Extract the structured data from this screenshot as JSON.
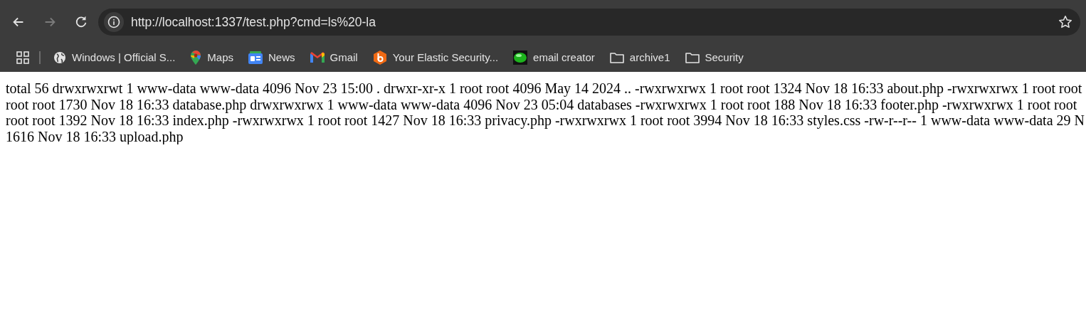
{
  "toolbar": {
    "nav_buttons": [
      {
        "kind": "back",
        "disabled": false
      },
      {
        "kind": "forward",
        "disabled": true
      },
      {
        "kind": "reload",
        "disabled": false
      }
    ],
    "url": "http://localhost:1337/test.php?cmd=ls%20-la"
  },
  "bookmarks": [
    {
      "kind": "globe",
      "label": "Windows | Official S..."
    },
    {
      "kind": "pin",
      "label": "Maps"
    },
    {
      "kind": "news",
      "label": "News"
    },
    {
      "kind": "mail",
      "label": "Gmail"
    },
    {
      "kind": "hexagon",
      "label": "Your Elastic Security..."
    },
    {
      "kind": "orb",
      "label": "email creator"
    },
    {
      "kind": "folder",
      "label": "archive1"
    },
    {
      "kind": "folder",
      "label": "Security"
    }
  ],
  "page": {
    "lines": [
      "total 56 drwxrwxrwt 1 www-data www-data 4096 Nov 23 15:00 . drwxr-xr-x 1 root root 4096 May 14 2024 .. -rwxrwxrwx 1 root root 1324 Nov 18 16:33 about.php -rwxrwxrwx 1 root root",
      "root root 1730 Nov 18 16:33 database.php drwxrwxrwx 1 www-data www-data 4096 Nov 23 05:04 databases -rwxrwxrwx 1 root root 188 Nov 18 16:33 footer.php -rwxrwxrwx 1 root root",
      "root root 1392 Nov 18 16:33 index.php -rwxrwxrwx 1 root root 1427 Nov 18 16:33 privacy.php -rwxrwxrwx 1 root root 3994 Nov 18 16:33 styles.css -rw-r--r-- 1 www-data www-data 29 N",
      "1616 Nov 18 16:33 upload.php"
    ]
  }
}
